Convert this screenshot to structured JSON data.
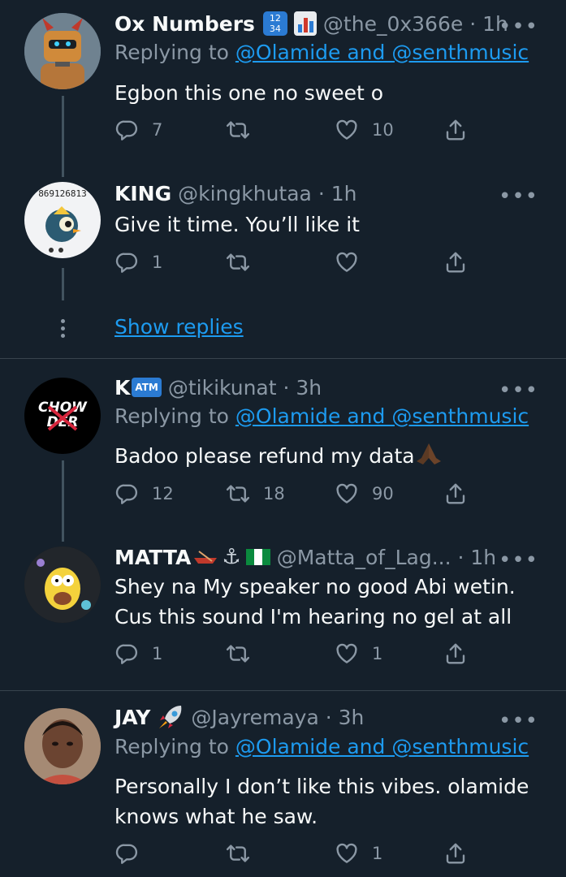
{
  "replying_label": "Replying to",
  "mentions": "@Olamide and @senthmusic",
  "show_replies": "Show replies",
  "more": "•••",
  "tweets": [
    {
      "name": "Ox Numbers",
      "name_suffix": "1234 bar-chart-emoji",
      "handle": "@the_0x366e · 1h",
      "text": "Egbon this one no sweet o",
      "replies": "7",
      "retweets": "",
      "likes": "10"
    },
    {
      "name": "KING",
      "handle": "@kingkhutaa · 1h",
      "avatar_text": "869126813",
      "text": "Give it time. You’ll like it",
      "replies": "1",
      "retweets": "",
      "likes": ""
    },
    {
      "name": "K",
      "name_suffix": "ATM",
      "handle": "@tikikunat · 3h",
      "avatar_text": "CHOW DER",
      "text": "Badoo please refund my data",
      "text_emoji": "praying-hands-emoji",
      "replies": "12",
      "retweets": "18",
      "likes": "90"
    },
    {
      "name": "MATTA",
      "name_suffix": "canoe-emoji anchor-emoji nigeria-flag",
      "handle": "@Matta_of_Lag... · 1h",
      "text": "Shey na My speaker no good Abi wetin. Cus this sound I'm hearing no gel at all",
      "replies": "1",
      "retweets": "",
      "likes": "1"
    },
    {
      "name": "JAY",
      "name_suffix": "rocket-emoji",
      "handle": "@Jayremaya · 3h",
      "text": "Personally I don’t like this vibes. olamide knows what he saw.",
      "replies": "",
      "retweets": "",
      "likes": "1"
    }
  ],
  "icons": {
    "reply": "reply-icon",
    "retweet": "retweet-icon",
    "like": "heart-icon",
    "share": "share-icon",
    "more": "more-icon"
  },
  "colors": {
    "background": "#15202b",
    "text": "#f7f9f9",
    "secondary": "#8b98a5",
    "link": "#1d9bf0",
    "thread_line": "#42535f",
    "divider": "#38444d"
  }
}
